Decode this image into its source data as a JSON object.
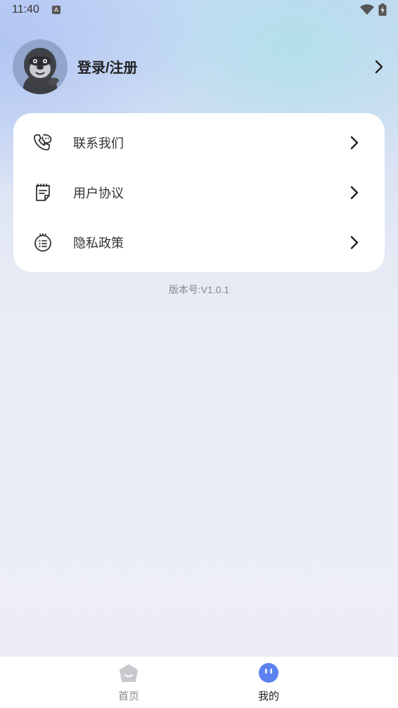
{
  "status_bar": {
    "time": "11:40",
    "notification_badge": "A"
  },
  "profile": {
    "login_label": "登录/注册"
  },
  "menu": {
    "items": [
      {
        "label": "联系我们",
        "icon": "phone-chat-icon"
      },
      {
        "label": "用户协议",
        "icon": "document-icon"
      },
      {
        "label": "隐私政策",
        "icon": "list-face-icon"
      }
    ]
  },
  "version": "版本号:V1.0.1",
  "tab_bar": {
    "tabs": [
      {
        "label": "首页",
        "active": false
      },
      {
        "label": "我的",
        "active": true
      }
    ],
    "active_color": "#5b82f0",
    "inactive_color": "#c9c9cd"
  }
}
